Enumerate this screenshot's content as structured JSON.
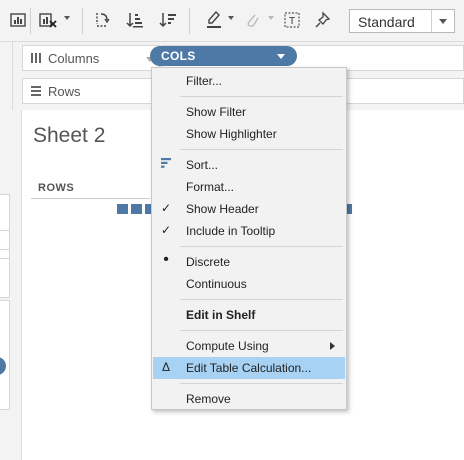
{
  "toolbar": {
    "fit_selector_value": "Standard",
    "icons": [
      "show-me-icon",
      "clear-sheet-icon",
      "swap-icon",
      "sort-ascending-icon",
      "sort-descending-icon",
      "highlight-icon",
      "group-icon",
      "label-icon",
      "pin-icon"
    ]
  },
  "shelves": {
    "columns_label": "Columns",
    "rows_label": "Rows",
    "columns_pill": "COLS"
  },
  "worksheet": {
    "title": "Sheet 2",
    "rows_header": "ROWS",
    "mark_color": "#4e79a7"
  },
  "context_menu": {
    "items": [
      {
        "label": "Filter..."
      },
      {
        "label": "Show Filter"
      },
      {
        "label": "Show Highlighter"
      },
      {
        "label": "Sort..."
      },
      {
        "label": "Format..."
      },
      {
        "label": "Show Header",
        "checked": true
      },
      {
        "label": "Include in Tooltip",
        "checked": true
      },
      {
        "label": "Discrete",
        "selected": true
      },
      {
        "label": "Continuous"
      },
      {
        "label": "Edit in Shelf"
      },
      {
        "label": "Compute Using",
        "submenu": true
      },
      {
        "label": "Edit Table Calculation...",
        "highlighted": true
      },
      {
        "label": "Remove"
      }
    ],
    "glyphs": {
      "check": "✓",
      "bullet": "•",
      "delta": "Δ"
    },
    "highlight_color": "#a7d2f3"
  }
}
